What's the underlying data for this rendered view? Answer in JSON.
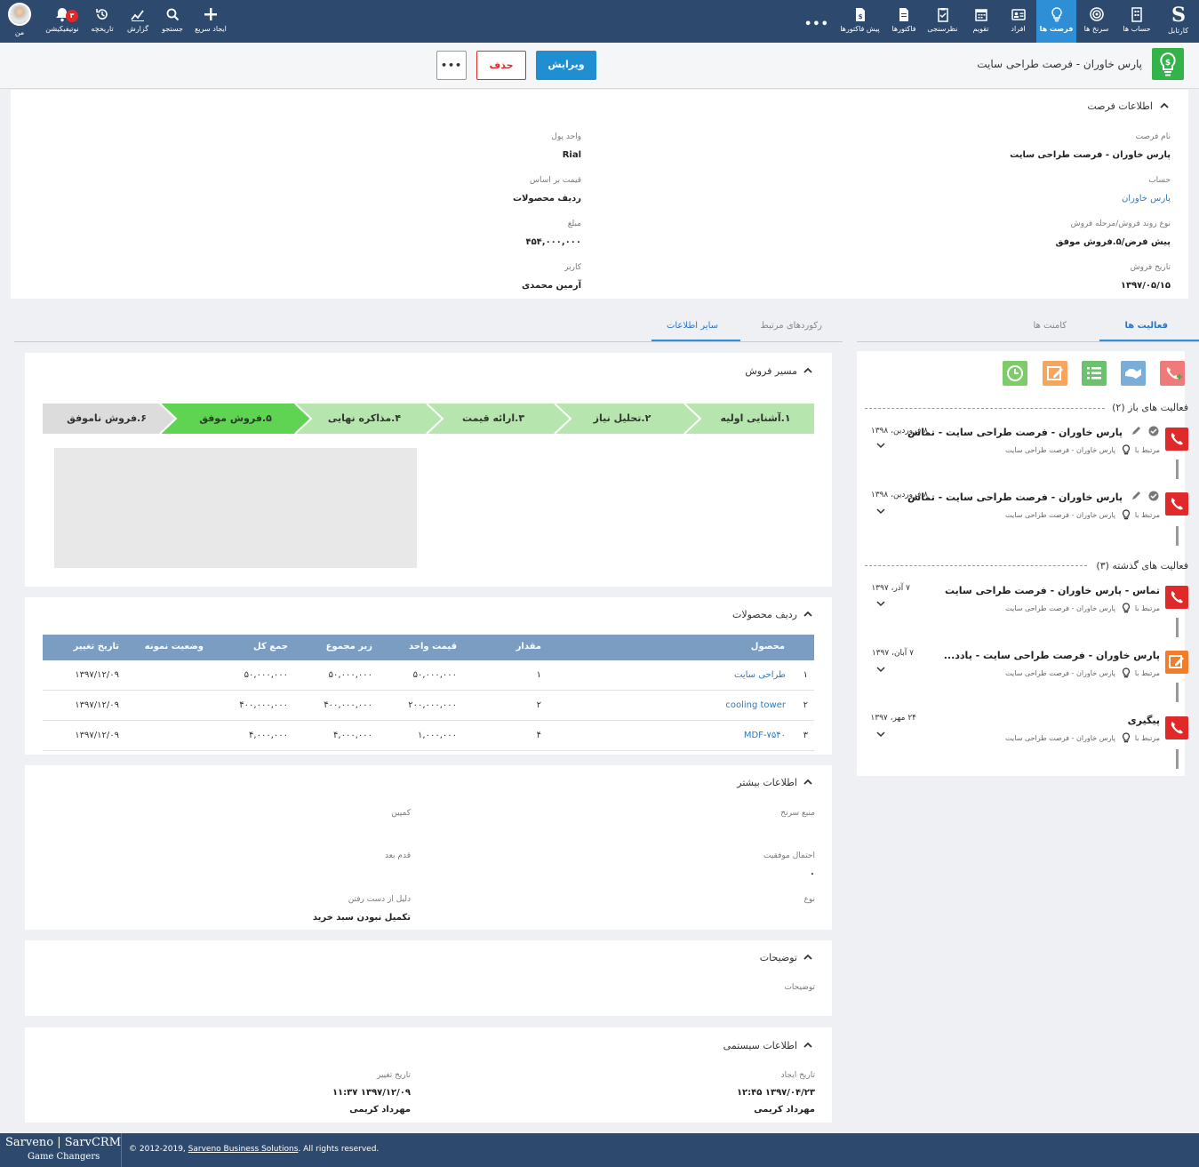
{
  "topnav": {
    "right_items": [
      {
        "id": "home",
        "label": "کارتابل",
        "icon": "s-logo-icon"
      },
      {
        "id": "accounts",
        "label": "حساب ها",
        "icon": "building-icon"
      },
      {
        "id": "leads",
        "label": "سرنخ ها",
        "icon": "target-icon"
      },
      {
        "id": "opportunities",
        "label": "فرصت ها",
        "icon": "lightbulb-icon",
        "active": true
      },
      {
        "id": "contacts",
        "label": "افراد",
        "icon": "contact-card-icon"
      },
      {
        "id": "calendar",
        "label": "تقویم",
        "icon": "calendar-icon"
      },
      {
        "id": "surveys",
        "label": "نظرسنجی",
        "icon": "clipboard-icon"
      },
      {
        "id": "invoices",
        "label": "فاکتورها",
        "icon": "document-icon"
      },
      {
        "id": "preinvoices",
        "label": "پیش فاکتورها",
        "icon": "document-dollar-icon"
      }
    ],
    "more_label": "•••",
    "left_items": [
      {
        "id": "quick-create",
        "label": "ایجاد سریع",
        "icon": "plus-icon"
      },
      {
        "id": "search",
        "label": "جستجو",
        "icon": "search-icon"
      },
      {
        "id": "report",
        "label": "گزارش",
        "icon": "chart-icon"
      },
      {
        "id": "history",
        "label": "تاریخچه",
        "icon": "history-icon"
      },
      {
        "id": "notifications",
        "label": "نوتیفیکیشن",
        "icon": "bell-icon",
        "badge": "۳"
      },
      {
        "id": "me",
        "label": "من",
        "icon": "avatar"
      }
    ]
  },
  "header": {
    "title": "پارس خاوران - فرصت طراحی سایت",
    "edit_label": "ویرایش",
    "delete_label": "حذف",
    "more_label": "•••"
  },
  "opportunity_info": {
    "section_title": "اطلاعات فرصت",
    "fields": {
      "name_label": "نام فرصت",
      "name_value": "پارس خاوران - فرصت طراحی سایت",
      "account_label": "حساب",
      "account_value": "پارس خاوران",
      "stage_label": "نوع روند فروش/مرحله فروش",
      "stage_value": "پیش فرض/۵.فروش موفق",
      "date_label": "تاریخ فروش",
      "date_value": "۱۳۹۷/۰۵/۱۵",
      "currency_label": "واحد پول",
      "currency_value": "Rial",
      "price_basis_label": "قیمت بر اساس",
      "price_basis_value": "ردیف محصولات",
      "amount_label": "مبلغ",
      "amount_value": "۴۵۴,۰۰۰,۰۰۰",
      "user_label": "کاربر",
      "user_value": "آرمین محمدی"
    }
  },
  "left_tabs": {
    "other_info": "سایر اطلاعات",
    "related_records": "رکوردهای مرتبط"
  },
  "sales_path": {
    "title": "مسیر فروش",
    "stages": [
      {
        "label": "۱.آشنایی اولیه",
        "state": "done"
      },
      {
        "label": "۲.تحلیل نیاز",
        "state": "done"
      },
      {
        "label": "۳.ارائه قیمت",
        "state": "done"
      },
      {
        "label": "۴.مذاکره نهایی",
        "state": "done"
      },
      {
        "label": "۵.فروش موفق",
        "state": "current"
      },
      {
        "label": "۶.فروش ناموفق",
        "state": "other"
      }
    ]
  },
  "products": {
    "title": "ردیف محصولات",
    "headers": {
      "product": "محصول",
      "qty": "مقدار",
      "unit_price": "قیمت واحد",
      "subtotal": "زیر مجموع",
      "total": "جمع کل",
      "sample_status": "وضعیت نمونه",
      "changed": "تاریخ تغییر"
    },
    "rows": [
      {
        "n": "۱",
        "product": "طراحی سایت",
        "qty": "۱",
        "unit_price": "۵۰,۰۰۰,۰۰۰",
        "subtotal": "۵۰,۰۰۰,۰۰۰",
        "total": "۵۰,۰۰۰,۰۰۰",
        "changed": "۱۳۹۷/۱۲/۰۹"
      },
      {
        "n": "۲",
        "product": "cooling tower",
        "qty": "۲",
        "unit_price": "۲۰۰,۰۰۰,۰۰۰",
        "subtotal": "۴۰۰,۰۰۰,۰۰۰",
        "total": "۴۰۰,۰۰۰,۰۰۰",
        "changed": "۱۳۹۷/۱۲/۰۹"
      },
      {
        "n": "۳",
        "product": "MDF-۷۵۴۰",
        "qty": "۴",
        "unit_price": "۱,۰۰۰,۰۰۰",
        "subtotal": "۴,۰۰۰,۰۰۰",
        "total": "۴,۰۰۰,۰۰۰",
        "changed": "۱۳۹۷/۱۲/۰۹"
      }
    ]
  },
  "more_info": {
    "title": "اطلاعات بیشتر",
    "lead_source_label": "منبع سرنخ",
    "campaign_label": "کمپین",
    "probability_label": "احتمال موفقیت",
    "probability_value": "۰",
    "next_step_label": "قدم بعد",
    "type_label": "نوع",
    "loss_reason_label": "دلیل از دست رفتن",
    "loss_reason_value": "تکمیل نبودن سبد خرید"
  },
  "description": {
    "title": "توضیحات",
    "label": "توضیحات"
  },
  "system_info": {
    "title": "اطلاعات سیستمی",
    "created_label": "تاریخ ایجاد",
    "created_value": "۱۳۹۷/۰۴/۲۳ ۱۲:۴۵",
    "created_by": "مهرداد کریمی",
    "modified_label": "تاریخ تغییر",
    "modified_value": "۱۳۹۷/۱۲/۰۹ ۱۱:۳۷",
    "modified_by": "مهرداد کریمی"
  },
  "right_tabs": {
    "activities": "فعالیت ها",
    "comments": "کامنت ها"
  },
  "activities": {
    "open_header": "فعالیت های باز",
    "open_count": "(۲)",
    "past_header": "فعالیت های گذشته",
    "past_count": "(۳)",
    "related_prefix": "مرتبط با",
    "related_name": "پارس خاوران - فرصت طراحی سایت",
    "open": [
      {
        "title": "پارس خاوران - فرصت طراحی سایت - تماس",
        "date": "۸ فروردین، ۱۳۹۸",
        "type": "call"
      },
      {
        "title": "پارس خاوران - فرصت طراحی سایت - تماس",
        "date": "۸ فروردین، ۱۳۹۸",
        "type": "call"
      }
    ],
    "past": [
      {
        "title": "تماس - پارس خاوران - فرصت طراحی سایت",
        "date": "۷ آذر، ۱۳۹۷",
        "type": "call"
      },
      {
        "title": "پارس خاوران - فرصت طراحی سایت - یادد...",
        "date": "۷ آبان، ۱۳۹۷",
        "type": "note"
      },
      {
        "title": "پیگیری",
        "date": "۲۴ مهر، ۱۳۹۷",
        "type": "call"
      }
    ]
  },
  "footer": {
    "brand": "Sarveno | SarvCRM",
    "tagline": "Game Changers",
    "copyright_prefix": "© 2012-2019,",
    "company": "Sarveno Business Solutions",
    "copyright_suffix": ". All rights reserved."
  },
  "colors": {
    "nav_bg": "#2d4a6e",
    "nav_active": "#2f8fd6",
    "edit_btn": "#1f8fd1",
    "delete_btn": "#d9302c",
    "stage_done": "#b6e6ad",
    "stage_current": "#5ed452",
    "stage_other": "#dcdcdc",
    "table_header": "#7c9dc2",
    "call_icon": "#e02a2a",
    "note_icon": "#f27c2c",
    "link": "#2f78c4"
  }
}
